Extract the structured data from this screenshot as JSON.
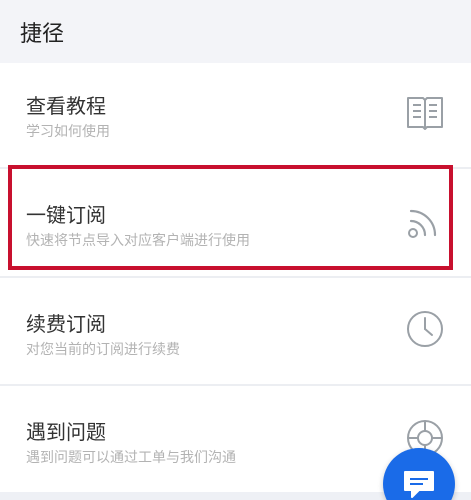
{
  "header": {
    "title": "捷径"
  },
  "items": [
    {
      "title": "查看教程",
      "desc": "学习如何使用",
      "icon": "book-icon"
    },
    {
      "title": "一键订阅",
      "desc": "快速将节点导入对应客户端进行使用",
      "icon": "rss-icon"
    },
    {
      "title": "续费订阅",
      "desc": "对您当前的订阅进行续费",
      "icon": "clock-icon"
    },
    {
      "title": "遇到问题",
      "desc": "遇到问题可以通过工单与我们沟通",
      "icon": "lifebuoy-icon"
    }
  ],
  "colors": {
    "highlight": "#c8102e",
    "fab": "#1a6be8",
    "header_bg": "#f3f4f8",
    "icon": "#9aa0a6"
  },
  "fab": {
    "icon": "chat-icon"
  }
}
